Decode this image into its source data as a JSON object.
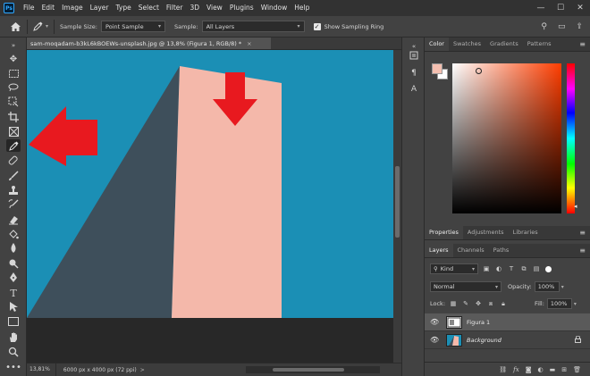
{
  "menubar": {
    "logo": "Ps",
    "items": [
      "File",
      "Edit",
      "Image",
      "Layer",
      "Type",
      "Select",
      "Filter",
      "3D",
      "View",
      "Plugins",
      "Window",
      "Help"
    ],
    "window_controls": [
      "—",
      "☐",
      "✕"
    ]
  },
  "options": {
    "sample_size_label": "Sample Size:",
    "sample_size_value": "Point Sample",
    "sample_label": "Sample:",
    "sample_value": "All Layers",
    "show_ring_label": "Show Sampling Ring",
    "show_ring_checked": true
  },
  "document": {
    "tab_title": "sam-moqadam-b3kL6kBOEWs-unsplash.jpg @ 13,8% (Figura 1, RGB/8) *",
    "close": "×"
  },
  "status": {
    "zoom": "13,81%",
    "doc_size": "6000 px x 4000 px (72 ppi)",
    "arrow": ">"
  },
  "color_panel": {
    "tabs": [
      "Color",
      "Swatches",
      "Gradients",
      "Patterns"
    ],
    "active_tab": "Color",
    "foreground": "#f4bfb0",
    "background": "#ffffff"
  },
  "properties_panel": {
    "tabs": [
      "Properties",
      "Adjustments",
      "Libraries"
    ],
    "active_tab": "Properties"
  },
  "layers_panel": {
    "tabs": [
      "Layers",
      "Channels",
      "Paths"
    ],
    "active_tab": "Layers",
    "filter_kind": "Kind",
    "blend_mode": "Normal",
    "opacity_label": "Opacity:",
    "opacity_value": "100%",
    "lock_label": "Lock:",
    "fill_label": "Fill:",
    "fill_value": "100%",
    "layers": [
      {
        "name": "Figura 1",
        "selected": true,
        "locked": false
      },
      {
        "name": "Background",
        "selected": false,
        "locked": true
      }
    ]
  },
  "colors": {
    "sky": "#1b8fb5",
    "building_light": "#f4b8aa",
    "building_shadow": "#3e4f5b",
    "annotation_arrow": "#e8191f"
  }
}
